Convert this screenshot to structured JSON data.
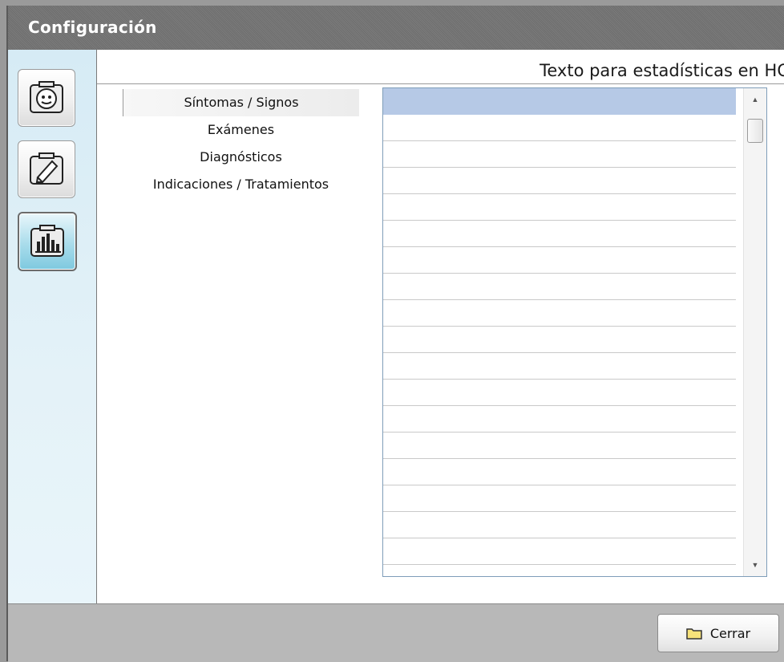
{
  "window": {
    "title": "Configuración"
  },
  "sidebar": {
    "buttons": [
      {
        "icon": "face-id-icon",
        "active": false
      },
      {
        "icon": "edit-document-icon",
        "active": false
      },
      {
        "icon": "bar-chart-icon",
        "active": true
      }
    ]
  },
  "header": {
    "title": "Texto para estadísticas en HC"
  },
  "categories": [
    {
      "label": "Síntomas / Signos",
      "selected": true
    },
    {
      "label": "Exámenes",
      "selected": false
    },
    {
      "label": "Diagnósticos",
      "selected": false
    },
    {
      "label": "Indicaciones / Tratamientos",
      "selected": false
    }
  ],
  "listbox": {
    "rows": [
      "",
      "",
      "",
      "",
      "",
      "",
      "",
      "",
      "",
      "",
      "",
      "",
      "",
      "",
      "",
      "",
      "",
      ""
    ],
    "selected_row": 0
  },
  "footer": {
    "close_label": "Cerrar",
    "close_icon": "folder-icon"
  },
  "colors": {
    "selection": "#b6c9e6",
    "sidebar_active": "#7ec9df",
    "titlebar": "#737373"
  }
}
